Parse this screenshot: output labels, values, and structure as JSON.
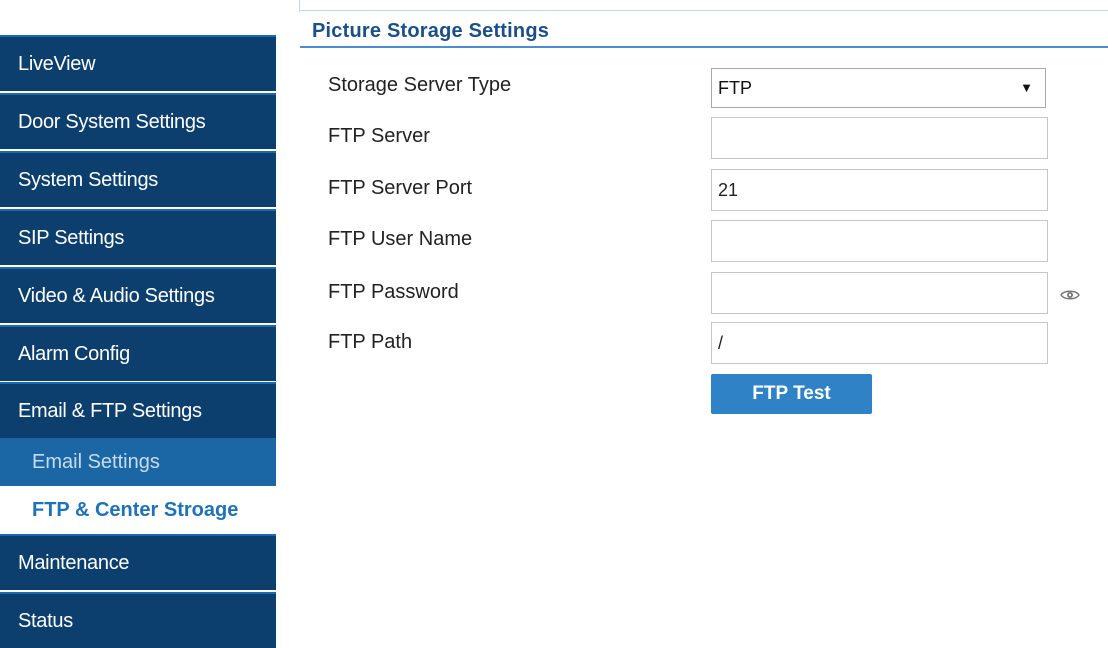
{
  "sidebar": {
    "items": [
      {
        "label": "LiveView"
      },
      {
        "label": "Door System Settings"
      },
      {
        "label": "System Settings"
      },
      {
        "label": "SIP Settings"
      },
      {
        "label": "Video & Audio Settings"
      },
      {
        "label": "Alarm Config"
      },
      {
        "label": "Email & FTP Settings"
      }
    ],
    "subitems": [
      {
        "label": "Email Settings",
        "active": false
      },
      {
        "label": "FTP & Center Stroage",
        "active": true
      }
    ],
    "bottom_items": [
      {
        "label": "Maintenance"
      },
      {
        "label": "Status"
      }
    ]
  },
  "section": {
    "title": "Picture Storage Settings"
  },
  "form": {
    "storage_server_type": {
      "label": "Storage Server Type",
      "value": "FTP",
      "caret": "▼"
    },
    "ftp_server": {
      "label": "FTP Server",
      "value": ""
    },
    "ftp_server_port": {
      "label": "FTP Server Port",
      "value": "21"
    },
    "ftp_user_name": {
      "label": "FTP User Name",
      "value": ""
    },
    "ftp_password": {
      "label": "FTP Password",
      "value": ""
    },
    "ftp_path": {
      "label": "FTP Path",
      "value": "/"
    }
  },
  "buttons": {
    "ftp_test": "FTP Test"
  },
  "icons": {
    "password_toggle": "eye-icon"
  },
  "colors": {
    "sidebar_bg": "#0c3f6d",
    "sidebar_sub_bg": "#1b67a5",
    "accent": "#2f82c6",
    "title": "#1a4f87"
  }
}
